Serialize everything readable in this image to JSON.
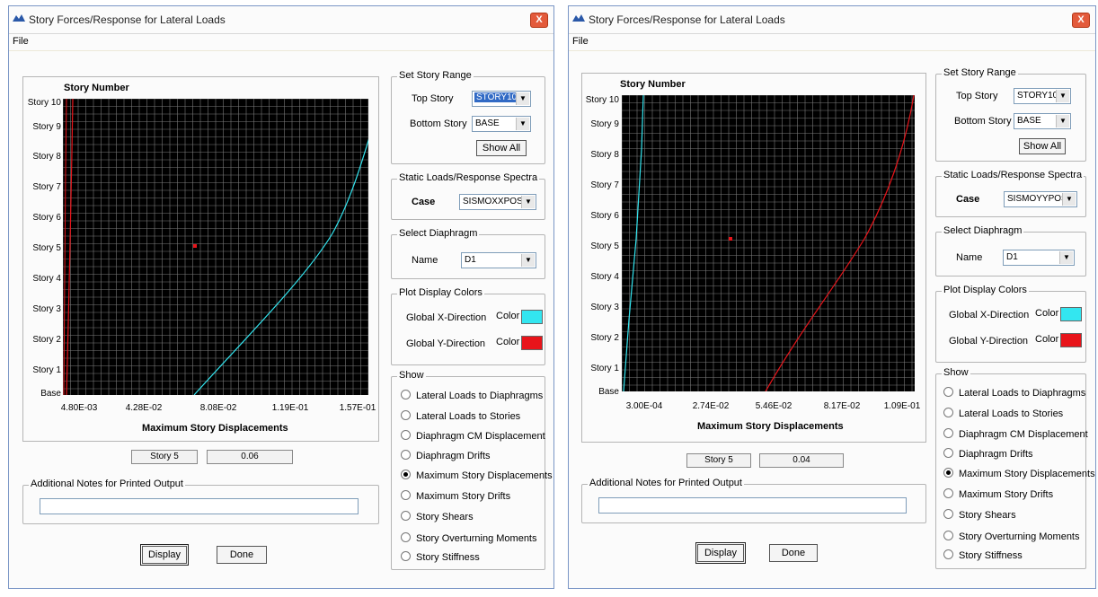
{
  "windows": [
    {
      "title": "Story Forces/Response for Lateral Loads",
      "close_label": "X",
      "menu": {
        "file": "File"
      },
      "plot": {
        "y_title": "Story Number",
        "y_labels": [
          "Story 10",
          "Story 9",
          "Story 8",
          "Story 7",
          "Story 6",
          "Story 5",
          "Story 4",
          "Story 3",
          "Story 2",
          "Story 1",
          "Base"
        ],
        "x_labels": [
          "4.80E-03",
          "4.28E-02",
          "8.08E-02",
          "1.19E-01",
          "1.57E-01"
        ],
        "x_title": "Maximum Story Displacements",
        "readout_story": "Story 5",
        "readout_value": "0.06"
      },
      "story_range": {
        "legend": "Set Story Range",
        "top_label": "Top Story",
        "top_value": "STORY10",
        "bottom_label": "Bottom Story",
        "bottom_value": "BASE",
        "show_all": "Show All"
      },
      "static": {
        "legend": "Static Loads/Response Spectra",
        "case_label": "Case",
        "case_value": "SISMOXXPOS"
      },
      "diaphragm": {
        "legend": "Select  Diaphragm",
        "name_label": "Name",
        "name_value": "D1"
      },
      "colors": {
        "legend": "Plot Display Colors",
        "x_label": "Global X-Direction",
        "y_label": "Global Y-Direction",
        "color_label": "Color",
        "x_color": "#33e6f0",
        "y_color": "#e8141a"
      },
      "show": {
        "legend": "Show",
        "options": [
          "Lateral Loads to Diaphragms",
          "Lateral Loads to Stories",
          "Diaphragm CM Displacement",
          "Diaphragm Drifts",
          "Maximum Story Displacements",
          "Maximum Story Drifts",
          "Story Shears",
          "Story Overturning Moments",
          "Story Stiffness"
        ],
        "selected": 4
      },
      "notes_legend": "Additional Notes for Printed Output",
      "display_button": "Display",
      "done_button": "Done"
    },
    {
      "title": "Story Forces/Response for Lateral Loads",
      "close_label": "X",
      "menu": {
        "file": "File"
      },
      "plot": {
        "y_title": "Story Number",
        "y_labels": [
          "Story 10",
          "Story 9",
          "Story 8",
          "Story 7",
          "Story 6",
          "Story 5",
          "Story 4",
          "Story 3",
          "Story 2",
          "Story 1",
          "Base"
        ],
        "x_labels": [
          "3.00E-04",
          "2.74E-02",
          "5.46E-02",
          "8.17E-02",
          "1.09E-01"
        ],
        "x_title": "Maximum Story Displacements",
        "readout_story": "Story 5",
        "readout_value": "0.04"
      },
      "story_range": {
        "legend": "Set Story Range",
        "top_label": "Top Story",
        "top_value": "STORY10",
        "bottom_label": "Bottom Story",
        "bottom_value": "BASE",
        "show_all": "Show All"
      },
      "static": {
        "legend": "Static Loads/Response Spectra",
        "case_label": "Case",
        "case_value": "SISMOYYPOS"
      },
      "diaphragm": {
        "legend": "Select  Diaphragm",
        "name_label": "Name",
        "name_value": "D1"
      },
      "colors": {
        "legend": "Plot Display Colors",
        "x_label": "Global X-Direction",
        "y_label": "Global Y-Direction",
        "color_label": "Color",
        "x_color": "#33e6f0",
        "y_color": "#e8141a"
      },
      "show": {
        "legend": "Show",
        "options": [
          "Lateral Loads to Diaphragms",
          "Lateral Loads to Stories",
          "Diaphragm CM Displacement",
          "Diaphragm Drifts",
          "Maximum Story Displacements",
          "Maximum Story Drifts",
          "Story Shears",
          "Story Overturning Moments",
          "Story Stiffness"
        ],
        "selected": 4
      },
      "notes_legend": "Additional Notes for Printed Output",
      "display_button": "Display",
      "done_button": "Done"
    }
  ]
}
